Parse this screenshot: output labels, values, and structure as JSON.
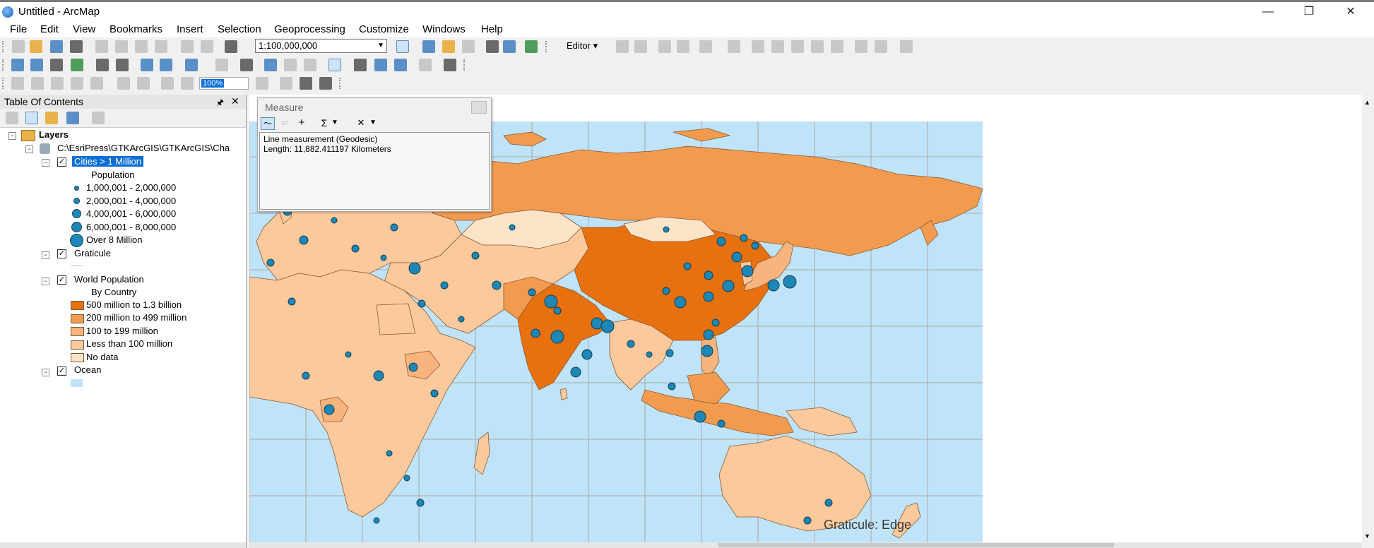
{
  "window": {
    "title": "Untitled - ArcMap",
    "minimize": "—",
    "maximize": "❐",
    "close": "✕"
  },
  "menu": [
    "File",
    "Edit",
    "View",
    "Bookmarks",
    "Insert",
    "Selection",
    "Geoprocessing",
    "Customize",
    "Windows",
    "Help"
  ],
  "toolbar": {
    "scale_value": "1:100,000,000",
    "editor_label": "Editor ▾",
    "zoom_value": "100%"
  },
  "toc": {
    "title": "Table Of Contents",
    "pin": "🖈",
    "close": "✕",
    "root": "Layers",
    "dataframe": "C:\\EsriPress\\GTKArcGIS\\GTKArcGIS\\Cha",
    "cities": {
      "name": "Cities > 1 Million",
      "field": "Population",
      "classes": [
        "1,000,001 - 2,000,000",
        "2,000,001 - 4,000,000",
        "4,000,001 - 6,000,000",
        "6,000,001 - 8,000,000",
        "Over 8 Million"
      ]
    },
    "graticule": {
      "name": "Graticule"
    },
    "world_pop": {
      "name": "World Population",
      "sub": "By Country",
      "classes": [
        "500 million to 1.3 billion",
        "200 million to 499 million",
        "100 to 199 million",
        "Less than 100 million",
        "No data"
      ],
      "colors": [
        "#e8710f",
        "#f29b4e",
        "#f7b47f",
        "#fbc99c",
        "#fde3c8"
      ]
    },
    "ocean": {
      "name": "Ocean",
      "color": "#bfe3f8"
    }
  },
  "measure": {
    "title": "Measure",
    "mode": "Line measurement (Geodesic)",
    "length": "Length: 11,882.411197 Kilometers"
  },
  "map": {
    "graticule_label": "Graticule: Edge",
    "ocean_color": "#bfe3f8",
    "land_colors": {
      "high": "#e8710f",
      "mid": "#f29b4e",
      "low": "#fbc99c",
      "none": "#fde3c8"
    },
    "city_color": "#1d87b5"
  }
}
